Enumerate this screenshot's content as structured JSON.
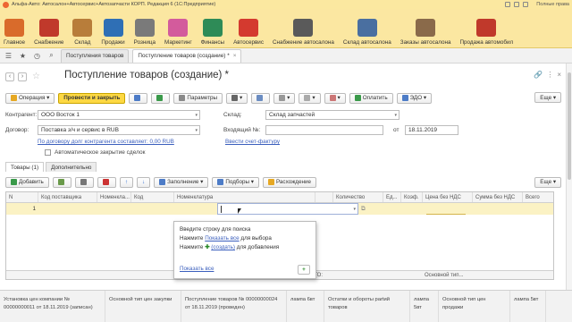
{
  "app": {
    "title": "Альфа-Авто: Автосалон+Автосервис+Автозапчасти КОРП. Редакция 6  (1С:Предприятие)",
    "user": "Полные права"
  },
  "sections": [
    {
      "label": "Главное",
      "icon": "home-icon",
      "color": "#d96b2b"
    },
    {
      "label": "Снабжение",
      "icon": "truck-icon",
      "color": "#c0392b"
    },
    {
      "label": "Склад",
      "icon": "warehouse-icon",
      "color": "#b87d3a"
    },
    {
      "label": "Продажи",
      "icon": "sales-icon",
      "color": "#2f6fb5"
    },
    {
      "label": "Розница",
      "icon": "cash-register-icon",
      "color": "#7a7a7a"
    },
    {
      "label": "Маркетинг",
      "icon": "marketing-icon",
      "color": "#d35b9c"
    },
    {
      "label": "Финансы",
      "icon": "finance-icon",
      "color": "#2e8b57"
    },
    {
      "label": "Автосервис",
      "icon": "car-service-icon",
      "color": "#d43a2f"
    },
    {
      "label": "Снабжение автосалона",
      "icon": "calculator-icon",
      "color": "#5a5a5a"
    },
    {
      "label": "Склад автосалона",
      "icon": "garage-icon",
      "color": "#4a6fa0"
    },
    {
      "label": "Заказы автосалона",
      "icon": "orders-icon",
      "color": "#8a6a4a"
    },
    {
      "label": "Продажа автомобил",
      "icon": "car-sale-icon",
      "color": "#c0392b"
    }
  ],
  "tabs": [
    {
      "label": "Поступления товаров"
    },
    {
      "label": "Поступление товаров (создание) *"
    }
  ],
  "form": {
    "title": "Поступление товаров (создание) *",
    "buttons": {
      "operation": "Операция",
      "post_close": "Провести и закрыть",
      "params": "Параметры",
      "pay": "Оплатить",
      "edo": "ЭДО",
      "more": "Еще"
    },
    "contractor_label": "Контрагент:",
    "contractor": "ООО Восток 1",
    "warehouse_label": "Склад:",
    "warehouse": "Склад запчастей",
    "contract_label": "Договор:",
    "contract": "Поставка з/ч и сервис в RUB",
    "incoming_label": "Входящий №:",
    "incoming": "",
    "from_label": "от",
    "date": "18.11.2019",
    "debt_link": "По договору долг контрагента составляет: 0,00 RUB",
    "invoice_link": "Ввести счет-фактуру",
    "auto_close": "Автоматическое закрытие сделок"
  },
  "page_tabs": [
    {
      "label": "Товары (1)"
    },
    {
      "label": "Дополнительно"
    }
  ],
  "table_toolbar": {
    "add": "Добавить",
    "fill": "Заполнение",
    "select": "Подборы",
    "discrepancy": "Расхождение",
    "more": "Еще"
  },
  "table": {
    "columns": [
      "N",
      "Код поставщика",
      "Номенкла...",
      "Код",
      "Номенклатура",
      "",
      "Количество",
      "Ед...",
      "Коэф.",
      "Цена без НДС",
      "Сумма без НДС",
      "Всего"
    ],
    "row": {
      "n": "1"
    },
    "footer_total": "ИТОГО:",
    "footer_price": "Основной тип..."
  },
  "popup": {
    "line1": "Введите строку для поиска",
    "line2_pre": "Нажмите ",
    "line2_link": "Показать все",
    "line2_post": " для выбора",
    "line3_pre": "Нажмите ",
    "line3_link": "(создать)",
    "line3_post": " для добавления",
    "show_all": "Показать все"
  },
  "status": [
    "Установка цен компании №\n00000000011 от 18.11.2019 (записан)",
    "Основной тип цен закупки",
    "Поступление товаров № 00000000024\nот 18.11.2019 (проведен)",
    "лампа 6вт",
    "Остатки и обороты partий товаров",
    "лампа 5вт",
    "Основной тип цен продажи",
    "лампа 5вт"
  ]
}
